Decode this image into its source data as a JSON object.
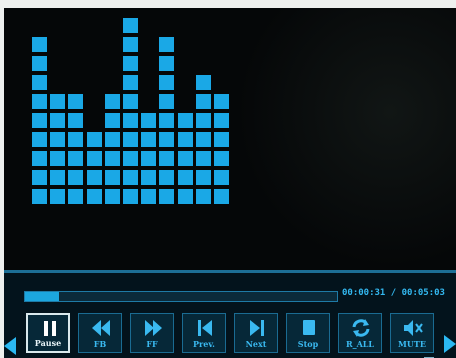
{
  "visualizer": {
    "color": "#1aa8e6",
    "bars": [
      9,
      6,
      6,
      4,
      6,
      10,
      5,
      9,
      5,
      7,
      6
    ]
  },
  "playback": {
    "progress": 0.11,
    "elapsed": "00:00:31",
    "separator": "/",
    "total": "00:05:03"
  },
  "controls": [
    {
      "name": "pause-button",
      "label": "Pause",
      "icon": "pause-icon",
      "active": true
    },
    {
      "name": "fast-backward-button",
      "label": "FB",
      "icon": "fast-backward-icon",
      "active": false
    },
    {
      "name": "fast-forward-button",
      "label": "FF",
      "icon": "fast-forward-icon",
      "active": false
    },
    {
      "name": "previous-button",
      "label": "Prev.",
      "icon": "skip-previous-icon",
      "active": false
    },
    {
      "name": "next-button",
      "label": "Next",
      "icon": "skip-next-icon",
      "active": false
    },
    {
      "name": "stop-button",
      "label": "Stop",
      "icon": "stop-icon",
      "active": false
    },
    {
      "name": "repeat-all-button",
      "label": "R_ALL",
      "icon": "repeat-icon",
      "active": false
    },
    {
      "name": "mute-button",
      "label": "MUTE",
      "icon": "speaker-mute-icon",
      "active": false
    }
  ],
  "colors": {
    "accent": "#1ca6de",
    "panel": "#03131c",
    "active_border": "#d9e8ec"
  }
}
